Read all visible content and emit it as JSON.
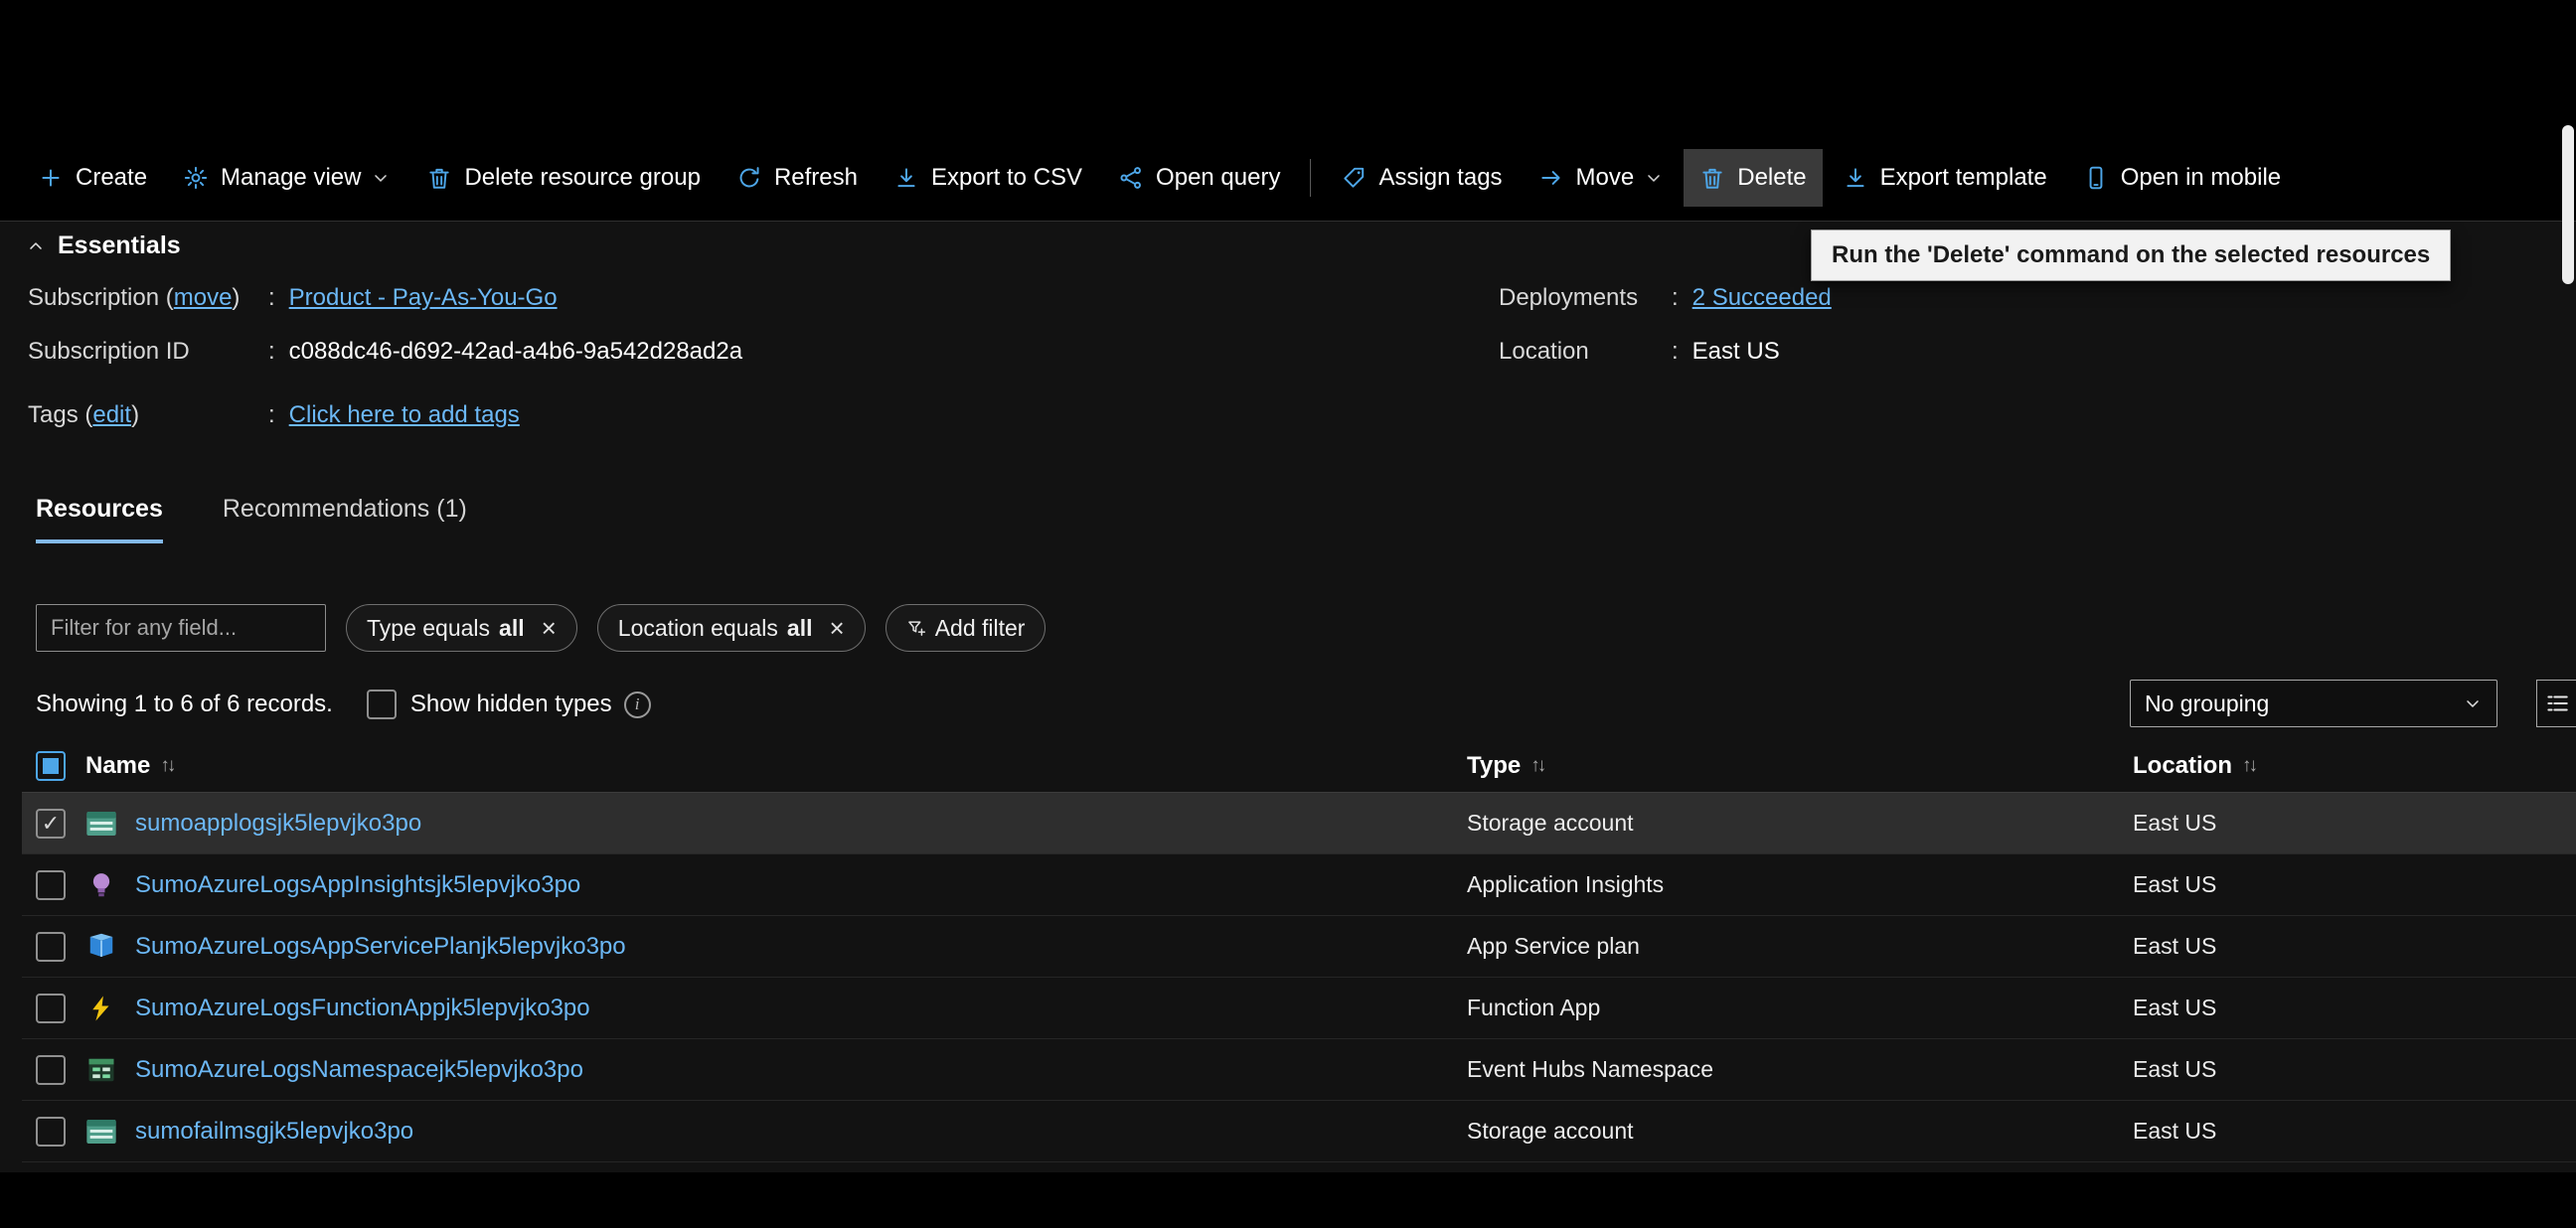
{
  "toolbar": {
    "items": [
      {
        "label": "Create",
        "icon": "plus-icon"
      },
      {
        "label": "Manage view",
        "icon": "gear-icon",
        "chevron": true
      },
      {
        "label": "Delete resource group",
        "icon": "trash-icon"
      },
      {
        "label": "Refresh",
        "icon": "refresh-icon"
      },
      {
        "label": "Export to CSV",
        "icon": "download-icon"
      },
      {
        "label": "Open query",
        "icon": "query-icon"
      },
      {
        "label": "Assign tags",
        "icon": "tag-icon"
      },
      {
        "label": "Move",
        "icon": "arrow-right-icon",
        "chevron": true
      },
      {
        "label": "Delete",
        "icon": "trash-icon",
        "highlighted": true
      },
      {
        "label": "Export template",
        "icon": "download-icon"
      },
      {
        "label": "Open in mobile",
        "icon": "mobile-icon"
      }
    ]
  },
  "tooltip": "Run the 'Delete' command on the selected resources",
  "essentials": {
    "title": "Essentials",
    "separator": ":",
    "subscription": {
      "pre": "Subscription (",
      "link_text": "move",
      "post": ")",
      "value": "Product - Pay-As-You-Go"
    },
    "subscription_id": {
      "label": "Subscription ID",
      "value": "c088dc46-d692-42ad-a4b6-9a542d28ad2a"
    },
    "tags": {
      "pre": "Tags (",
      "link_text": "edit",
      "post": ")",
      "value": "Click here to add tags"
    },
    "deployments": {
      "label": "Deployments",
      "value": "2 Succeeded"
    },
    "location": {
      "label": "Location",
      "value": "East US"
    }
  },
  "tabs": [
    {
      "label": "Resources",
      "active": true
    },
    {
      "label": "Recommendations (1)",
      "active": false
    }
  ],
  "filters": {
    "search_placeholder": "Filter for any field...",
    "pills": [
      {
        "text": "Type equals",
        "bold": "all"
      },
      {
        "text": "Location equals",
        "bold": "all"
      }
    ],
    "add_filter": "Add filter"
  },
  "status": {
    "showing": "Showing 1 to 6 of 6 records.",
    "show_hidden": "Show hidden types",
    "grouping": "No grouping"
  },
  "table": {
    "columns": [
      "Name",
      "Type",
      "Location"
    ],
    "rows": [
      {
        "name": "sumoapplogsjk5lepvjko3po",
        "type": "Storage account",
        "location": "East US",
        "icon": "storage-account-icon",
        "checked": true,
        "selected": true
      },
      {
        "name": "SumoAzureLogsAppInsightsjk5lepvjko3po",
        "type": "Application Insights",
        "location": "East US",
        "icon": "app-insights-icon",
        "checked": false,
        "selected": false
      },
      {
        "name": "SumoAzureLogsAppServicePlanjk5lepvjko3po",
        "type": "App Service plan",
        "location": "East US",
        "icon": "app-service-plan-icon",
        "checked": false,
        "selected": false
      },
      {
        "name": "SumoAzureLogsFunctionAppjk5lepvjko3po",
        "type": "Function App",
        "location": "East US",
        "icon": "function-app-icon",
        "checked": false,
        "selected": false
      },
      {
        "name": "SumoAzureLogsNamespacejk5lepvjko3po",
        "type": "Event Hubs Namespace",
        "location": "East US",
        "icon": "event-hubs-icon",
        "checked": false,
        "selected": false
      },
      {
        "name": "sumofailmsgjk5lepvjko3po",
        "type": "Storage account",
        "location": "East US",
        "icon": "storage-account-icon",
        "checked": false,
        "selected": false
      }
    ]
  },
  "colors": {
    "accent": "#4da6e8",
    "link": "#6cb8f6",
    "selected_row": "#2e2e2e"
  }
}
